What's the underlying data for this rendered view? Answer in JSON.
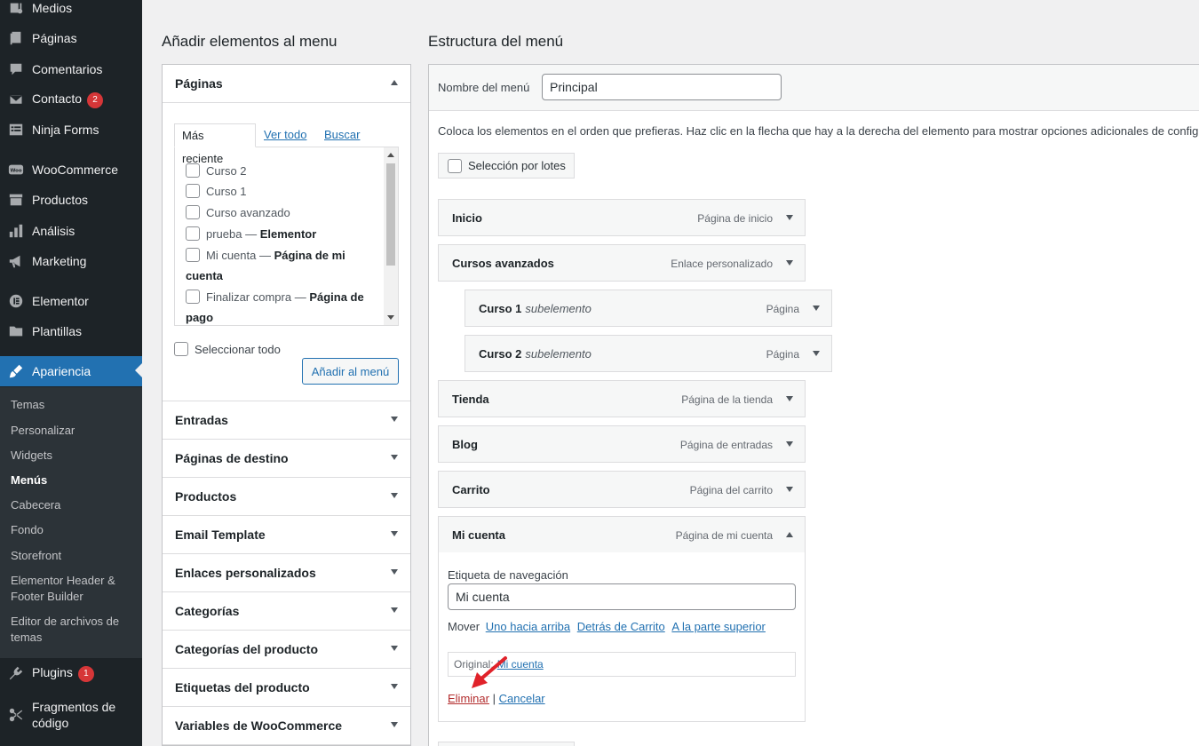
{
  "sidebar": {
    "items": [
      {
        "label": "Medios",
        "icon": "media-icon"
      },
      {
        "label": "Páginas",
        "icon": "pages-icon"
      },
      {
        "label": "Comentarios",
        "icon": "comments-icon"
      },
      {
        "label": "Contacto",
        "icon": "mail-icon",
        "badge": "2"
      },
      {
        "label": "Ninja Forms",
        "icon": "forms-icon"
      },
      {
        "label": "WooCommerce",
        "icon": "woo-icon"
      },
      {
        "label": "Productos",
        "icon": "products-icon"
      },
      {
        "label": "Análisis",
        "icon": "analytics-icon"
      },
      {
        "label": "Marketing",
        "icon": "megaphone-icon"
      },
      {
        "label": "Elementor",
        "icon": "elementor-icon"
      },
      {
        "label": "Plantillas",
        "icon": "folder-icon"
      },
      {
        "label": "Apariencia",
        "icon": "brush-icon"
      },
      {
        "label": "Plugins",
        "icon": "plugin-icon",
        "badge": "1"
      },
      {
        "label": "Fragmentos de código",
        "icon": "scissors-icon"
      }
    ],
    "submenu": [
      "Temas",
      "Personalizar",
      "Widgets",
      "Menús",
      "Cabecera",
      "Fondo",
      "Storefront",
      "Elementor Header & Footer Builder",
      "Editor de archivos de temas"
    ],
    "accent": "#2271b1"
  },
  "add_panel": {
    "title": "Añadir elementos al menu",
    "pages_section": "Páginas",
    "tabs": [
      "Más reciente",
      "Ver todo",
      "Buscar"
    ],
    "pages": [
      {
        "name": "Curso 2",
        "suffix": ""
      },
      {
        "name": "Curso 1",
        "suffix": ""
      },
      {
        "name": "Curso avanzado",
        "suffix": ""
      },
      {
        "name": "prueba — ",
        "suffix": "Elementor"
      },
      {
        "name": "Mi cuenta — ",
        "suffix": "Página de mi cuenta"
      },
      {
        "name": "Finalizar compra — ",
        "suffix": "Página de pago"
      }
    ],
    "select_all": "Seleccionar todo",
    "add_button": "Añadir al menú",
    "sections": [
      "Entradas",
      "Páginas de destino",
      "Productos",
      "Email Template",
      "Enlaces personalizados",
      "Categorías",
      "Categorías del producto",
      "Etiquetas del producto",
      "Variables de WooCommerce"
    ]
  },
  "structure": {
    "title": "Estructura del menú",
    "name_label": "Nombre del menú",
    "name_value": "Principal",
    "instructions": "Coloca los elementos en el orden que prefieras. Haz clic en la flecha que hay a la derecha del elemento para mostrar opciones adicionales de configuración.",
    "bulk": "Selección por lotes",
    "items": [
      {
        "title": "Inicio",
        "sub": "",
        "type": "Página de inicio"
      },
      {
        "title": "Cursos avanzados",
        "sub": "",
        "type": "Enlace personalizado"
      },
      {
        "title": "Curso 1",
        "sub": "subelemento",
        "type": "Página"
      },
      {
        "title": "Curso 2",
        "sub": "subelemento",
        "type": "Página"
      },
      {
        "title": "Tienda",
        "sub": "",
        "type": "Página de la tienda"
      },
      {
        "title": "Blog",
        "sub": "",
        "type": "Página de entradas"
      },
      {
        "title": "Carrito",
        "sub": "",
        "type": "Página del carrito"
      },
      {
        "title": "Mi cuenta",
        "sub": "",
        "type": "Página de mi cuenta"
      }
    ],
    "expanded": {
      "nav_label": "Etiqueta de navegación",
      "nav_value": "Mi cuenta",
      "move_label": "Mover",
      "move_links": [
        "Uno hacia arriba",
        "Detrás de Carrito",
        "A la parte superior"
      ],
      "original_label": "Original:",
      "original_link": "Mi cuenta",
      "delete": "Eliminar",
      "separator": "|",
      "cancel": "Cancelar"
    }
  },
  "colors": {
    "delete": "#b32d2e",
    "link": "#2271b1",
    "badge": "#d63638",
    "arrow": "#e0222a"
  }
}
